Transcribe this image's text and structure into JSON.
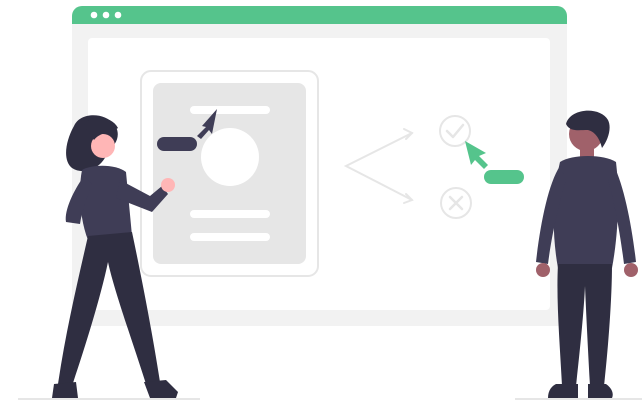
{
  "colors": {
    "accent": "#55c48c",
    "dark": "#3f3d56",
    "darker": "#2f2e41",
    "skin_light": "#ffb6b6",
    "skin_dark": "#a0616a",
    "window_bg": "#f2f2f2",
    "card_bg": "#e6e6e6",
    "white": "#ffffff"
  },
  "icons": {
    "window_dots": "three-dot-menu-icon",
    "approve": "check-circle-icon",
    "reject": "x-circle-icon",
    "cursor": "cursor-arrow-icon",
    "avatar": "avatar-placeholder-icon"
  }
}
